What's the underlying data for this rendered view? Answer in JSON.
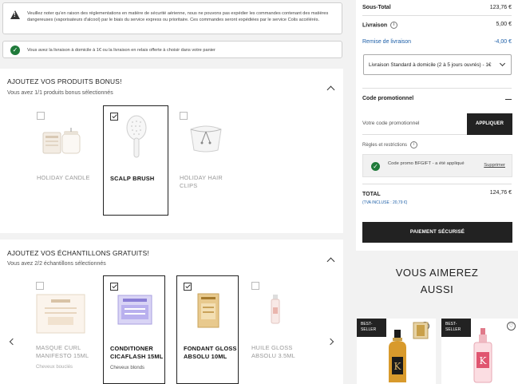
{
  "notices": {
    "warning": "Veuillez noter qu'en raison des réglementations en matière de sécurité aérienne, nous ne pouvons pas expédier les commandes contenant des matières dangereuses (vaporisateurs d'alcool) par le biais du service express ou prioritaire. Ces commandes seront expédiées par le service Colis accélérés.",
    "shipping": "Vous avez la livraison à domicile à 1€ ou la livraison en relais offerte à choisir dans votre panier"
  },
  "bonus": {
    "title": "AJOUTEZ VOS PRODUITS BONUS!",
    "subtitle": "Vous avez 1/1 produits bonus sélectionnés",
    "items": [
      {
        "name": "HOLIDAY CANDLE",
        "selected": false
      },
      {
        "name": "SCALP BRUSH",
        "selected": true
      },
      {
        "name": "HOLIDAY HAIR CLIPS",
        "selected": false
      }
    ]
  },
  "samples": {
    "title": "AJOUTEZ VOS ÉCHANTILLONS GRATUITS!",
    "subtitle": "Vous avez 2/2 échantillons sélectionnés",
    "items": [
      {
        "name": "MASQUE CURL MANIFESTO 15ML",
        "desc": "Cheveux bouclés",
        "selected": false
      },
      {
        "name": "CONDITIONER CICAFLASH 15ML",
        "desc": "Cheveux blonds",
        "selected": true
      },
      {
        "name": "FONDANT GLOSS ABSOLU 10ML",
        "desc": "",
        "selected": true
      },
      {
        "name": "HUILE GLOSS ABSOLU 3.5ML",
        "desc": "",
        "selected": false
      }
    ]
  },
  "summary": {
    "subtotal_label": "Sous-Total",
    "subtotal_value": "123,76 €",
    "shipping_label": "Livraison",
    "shipping_value": "5,00 €",
    "discount_label": "Remise de livraison",
    "discount_value": "-4,00 €",
    "shipping_option": "Livraison Standard à domicile (2 à 5 jours ouvrés) - 1€",
    "promo_title": "Code promotionnel",
    "promo_placeholder": "Votre code promotionnel",
    "apply_label": "APPLIQUER",
    "rules_label": "Règles et restrictions",
    "promo_applied": "Code promo BFGIFT - a été appliqué",
    "remove_label": "Supprimer",
    "total_label": "TOTAL",
    "total_value": "124,76 €",
    "tva_label": "(TVA INCLUSE : 20,79 €)",
    "pay_label": "PAIEMENT SÉCURISÉ"
  },
  "reco": {
    "title_line1": "VOUS AIMEREZ",
    "title_line2": "AUSSI",
    "badge_line1": "BEST-",
    "badge_line2": "SELLER"
  },
  "colors": {
    "accent_blue": "#1d5fa8",
    "success_green": "#1f7a3a",
    "dark": "#222222"
  }
}
